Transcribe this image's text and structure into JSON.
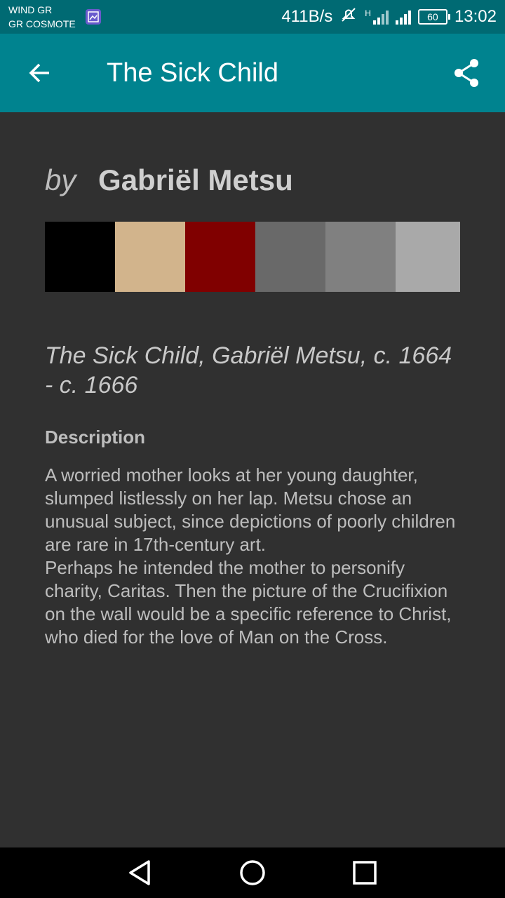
{
  "status_bar": {
    "carrier_1": "WIND GR",
    "carrier_2": "GR COSMOTE",
    "net_speed": "411B/s",
    "network_type": "H",
    "battery": "60",
    "time": "13:02"
  },
  "app_bar": {
    "title": "The Sick Child",
    "back_icon": "arrow-back-icon",
    "share_icon": "share-icon"
  },
  "artwork": {
    "by_prefix": "by",
    "artist": "Gabriël Metsu",
    "palette": [
      "#000000",
      "#d2b48c",
      "#800000",
      "#696969",
      "#808080",
      "#a9a9a9"
    ],
    "caption": "The Sick Child, Gabriël Metsu, c. 1664 - c. 1666",
    "description_heading": "Description",
    "description_p1": "A worried mother looks at her young daughter, slumped listlessly on her lap. Metsu chose an unusual subject, since depictions of poorly children are rare in 17th-century art.",
    "description_p2": "Perhaps he intended the mother to personify charity, Caritas. Then the picture of the Crucifixion on the wall would be a specific reference to Christ, who died for the love of Man on the Cross."
  },
  "nav_bar": {
    "back": "nav-back-icon",
    "home": "nav-home-icon",
    "recents": "nav-recents-icon"
  },
  "colors": {
    "app_bar": "#00838f",
    "status_bar": "#006a73",
    "background": "#303030"
  }
}
